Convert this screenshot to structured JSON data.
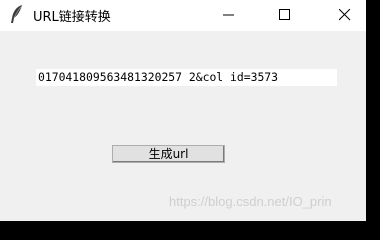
{
  "window": {
    "title": "URL链接转换"
  },
  "main": {
    "url_value": "017041809563481320257 2&col id=3573",
    "generate_button_label": "生成url"
  },
  "watermark": {
    "text": "https://blog.csdn.net/IO_prin"
  },
  "colors": {
    "window_background": "#f0f0f0",
    "title_bar_background": "#ffffff",
    "input_background": "#ffffff",
    "button_background": "#e1e1e1",
    "outer_background": "#000000"
  },
  "icons": {
    "app": "feather-icon",
    "minimize": "minimize-icon",
    "maximize": "maximize-icon",
    "close": "close-icon"
  }
}
